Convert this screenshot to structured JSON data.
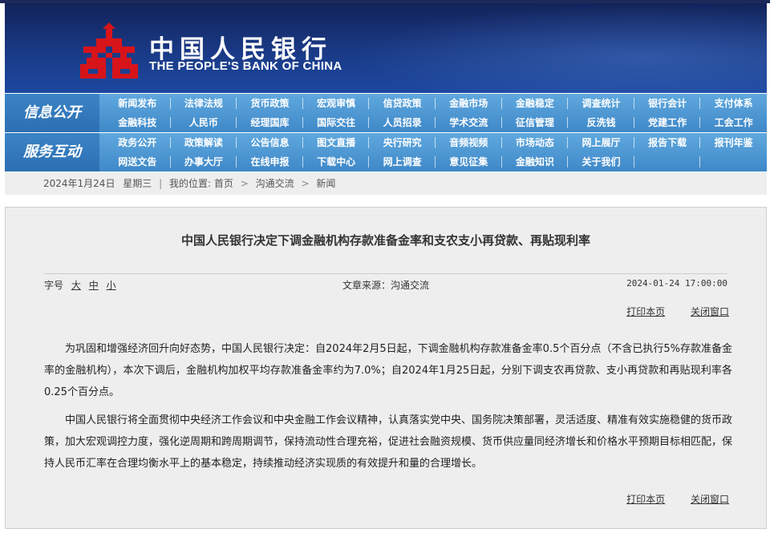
{
  "header": {
    "bank_name_cn": "中国人民银行",
    "bank_name_en": "THE PEOPLE'S BANK OF CHINA",
    "emblem": "pboc-emblem-icon",
    "banner_color": "#1a3a86",
    "emblem_color": "#d7141a"
  },
  "nav": {
    "info": {
      "heading": "信息公开",
      "items": [
        "新闻发布",
        "法律法规",
        "货币政策",
        "宏观审慎",
        "信贷政策",
        "金融市场",
        "金融稳定",
        "调查统计",
        "银行会计",
        "支付体系",
        "金融科技",
        "人民币",
        "经理国库",
        "国际交往",
        "人员招录",
        "学术交流",
        "征信管理",
        "反洗钱",
        "党建工作",
        "工会工作"
      ]
    },
    "service": {
      "heading": "服务互动",
      "items": [
        "政务公开",
        "政策解读",
        "公告信息",
        "图文直播",
        "央行研究",
        "音频视频",
        "市场动态",
        "网上展厅",
        "报告下载",
        "报刊年鉴",
        "网送文告",
        "办事大厅",
        "在线申报",
        "下载中心",
        "网上调查",
        "意见征集",
        "金融知识",
        "关于我们",
        "",
        ""
      ]
    }
  },
  "breadcrumb": {
    "date": "2024年1月24日",
    "weekday": "星期三",
    "location_label": "我的位置:",
    "home": "首页",
    "section": "沟通交流",
    "current": "新闻"
  },
  "article": {
    "title": "中国人民银行决定下调金融机构存款准备金率和支农支小再贷款、再贴现利率",
    "font_size_label": "字号",
    "font_large": "大",
    "font_medium": "中",
    "font_small": "小",
    "source": "文章来源：沟通交流",
    "datetime": "2024-01-24 17:00:00",
    "print_label": "打印本页",
    "close_label": "关闭窗口",
    "paragraphs": [
      "为巩固和增强经济回升向好态势，中国人民银行决定：自2024年2月5日起，下调金融机构存款准备金率0.5个百分点（不含已执行5%存款准备金率的金融机构），本次下调后，金融机构加权平均存款准备金率约为7.0%；自2024年1月25日起，分别下调支农再贷款、支小再贷款和再贴现利率各0.25个百分点。",
      "中国人民银行将全面贯彻中央经济工作会议和中央金融工作会议精神，认真落实党中央、国务院决策部署，灵活适度、精准有效实施稳健的货币政策，加大宏观调控力度，强化逆周期和跨周期调节，保持流动性合理充裕，促进社会融资规模、货币供应量同经济增长和价格水平预期目标相匹配，保持人民币汇率在合理均衡水平上的基本稳定，持续推动经济实现质的有效提升和量的合理增长。"
    ]
  }
}
